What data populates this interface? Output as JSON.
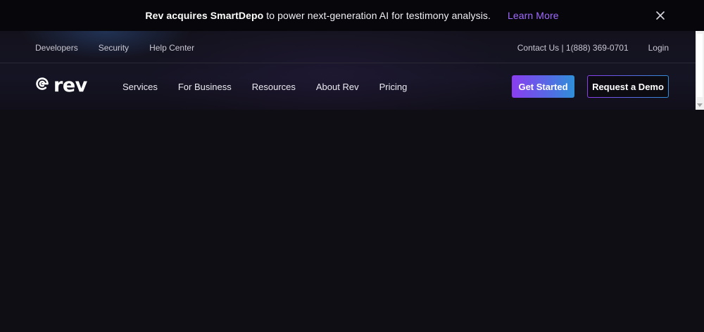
{
  "announcement": {
    "bold": "Rev acquires SmartDepo",
    "text": " to power next-generation AI for testimony analysis.",
    "link": "Learn More",
    "link_color": "#a06bff"
  },
  "utility_nav": {
    "left": [
      {
        "label": "Developers"
      },
      {
        "label": "Security"
      },
      {
        "label": "Help Center"
      }
    ],
    "contact": "Contact Us | 1(888) 369-0701",
    "login": "Login"
  },
  "logo": {
    "wordmark": "rev"
  },
  "main_nav": {
    "items": [
      {
        "label": "Services"
      },
      {
        "label": "For Business"
      },
      {
        "label": "Resources"
      },
      {
        "label": "About Rev"
      },
      {
        "label": "Pricing"
      }
    ]
  },
  "cta": {
    "get_started": "Get Started",
    "request_demo": "Request a Demo"
  },
  "colors": {
    "background": "#0f0e14",
    "gradient_start": "#8a3df0",
    "gradient_end": "#2f8fd8"
  }
}
